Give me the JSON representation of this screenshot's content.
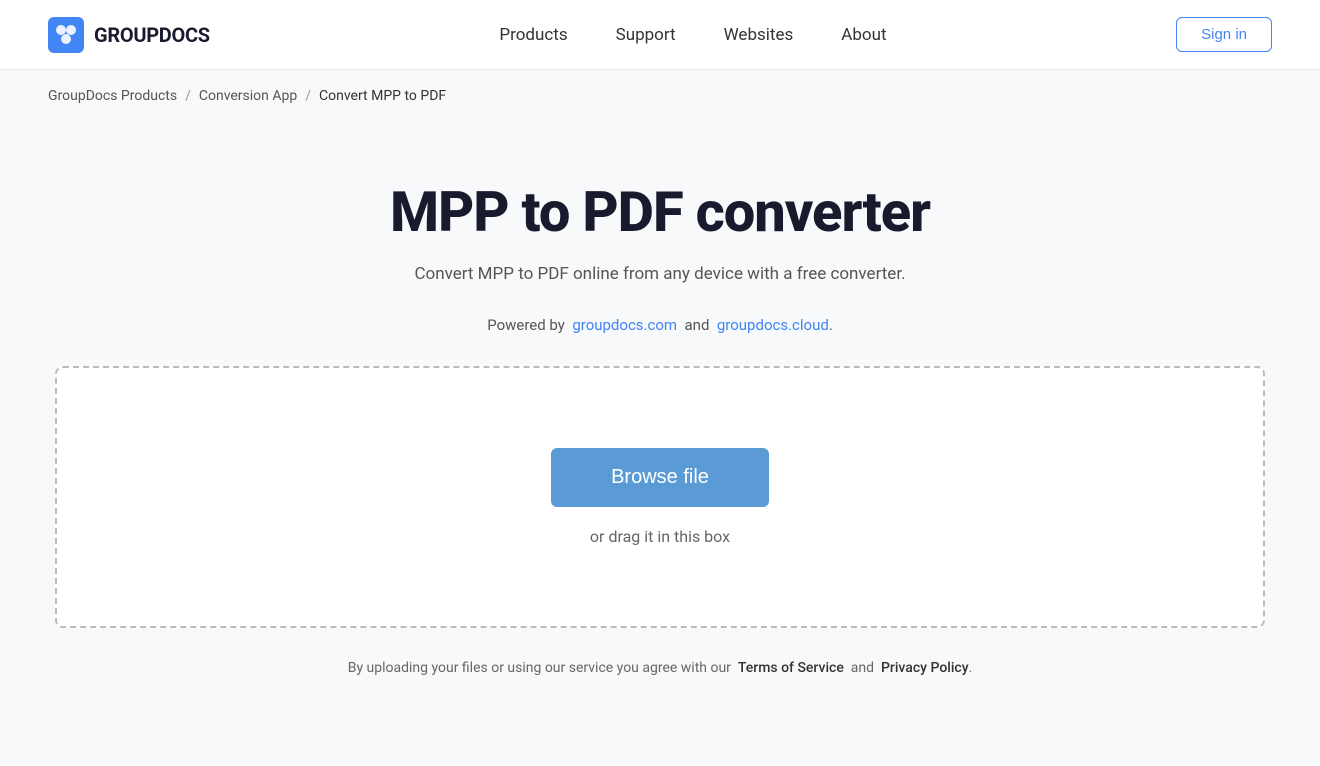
{
  "header": {
    "logo_text": "GROUPDOCS",
    "nav_items": [
      {
        "label": "Products",
        "href": "#"
      },
      {
        "label": "Support",
        "href": "#"
      },
      {
        "label": "Websites",
        "href": "#"
      },
      {
        "label": "About",
        "href": "#"
      }
    ],
    "sign_in_label": "Sign in"
  },
  "breadcrumb": {
    "items": [
      {
        "label": "GroupDocs Products",
        "href": "#"
      },
      {
        "label": "Conversion App",
        "href": "#"
      },
      {
        "label": "Convert MPP to PDF",
        "href": null
      }
    ],
    "separator": "/"
  },
  "main": {
    "page_title": "MPP to PDF converter",
    "subtitle": "Convert MPP to PDF online from any device with a free converter.",
    "powered_by_prefix": "Powered by",
    "powered_by_link1_text": "groupdocs.com",
    "powered_by_link1_href": "#",
    "powered_by_and": "and",
    "powered_by_link2_text": "groupdocs.cloud",
    "powered_by_link2_href": "#",
    "powered_by_suffix": ".",
    "upload": {
      "browse_btn_label": "Browse file",
      "drag_text": "or drag it in this box"
    },
    "footer_note_prefix": "By uploading your files or using our service you agree with our",
    "footer_note_tos": "Terms of Service",
    "footer_note_and": "and",
    "footer_note_privacy": "Privacy Policy",
    "footer_note_suffix": "."
  }
}
